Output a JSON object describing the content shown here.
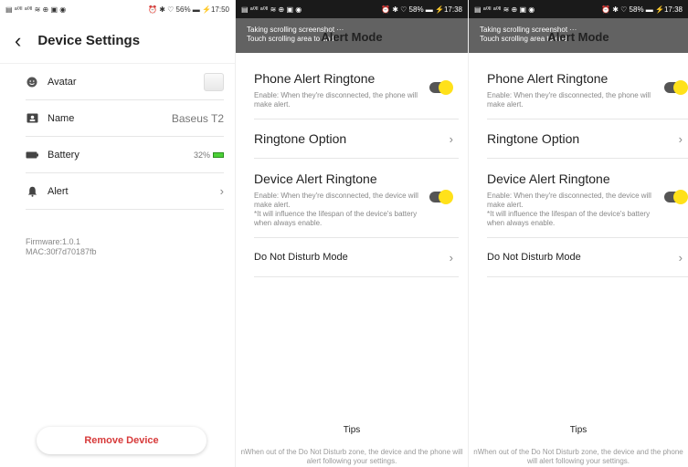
{
  "screen1": {
    "status_left": "▤ ᵃ⁰ˡˡ ᵃ⁰ˡˡ ≋ ⊕ ▣ ◉",
    "status_right": "⏰ ✱ ♡ 56% ▬ ⚡17:50",
    "title": "Device Settings",
    "rows": [
      {
        "label": "Avatar"
      },
      {
        "label": "Name",
        "value": "Baseus T2"
      },
      {
        "label": "Battery",
        "value": "32%"
      },
      {
        "label": "Alert"
      }
    ],
    "firmware": "Firmware:1.0.1",
    "mac": "MAC:30f7d70187fb",
    "remove_label": "Remove Device"
  },
  "screen2": {
    "status_left": "▤ ᵃ⁰ˡˡ ᵃ⁰ˡˡ ≋ ⊕ ▣ ◉",
    "status_right": "⏰ ✱ ♡ 58% ▬ ⚡17:38",
    "toast_line1": "Taking scrolling screenshot ···",
    "toast_line2": "Touch scrolling area to end",
    "title": "Alert Mode",
    "phone_alert_title": "Phone Alert Ringtone",
    "phone_alert_desc": "Enable: When they're disconnected, the phone will make alert.",
    "ringtone_option": "Ringtone Option",
    "device_alert_title": "Device Alert Ringtone",
    "device_alert_desc": "Enable: When they're disconnected, the device will make alert.\n*It will influence the lifespan of the device's battery when always enable.",
    "dnd": "Do Not Disturb Mode",
    "tips_title": "Tips",
    "tips_text": "nWhen out of the Do Not Disturb zone, the device and the phone will alert following your settings."
  },
  "screen3": {
    "status_left": "▤ ᵃ⁰ˡˡ ᵃ⁰ˡˡ ≋ ⊕ ▣ ◉",
    "status_right": "⏰ ✱ ♡ 58% ▬ ⚡17:38",
    "toast_line1": "Taking scrolling screenshot ···",
    "toast_line2": "Touch scrolling area to end",
    "title": "Alert Mode",
    "phone_alert_title": "Phone Alert Ringtone",
    "phone_alert_desc": "Enable: When they're disconnected, the phone will make alert.",
    "ringtone_option": "Ringtone Option",
    "device_alert_title": "Device Alert Ringtone",
    "device_alert_desc": "Enable: When they're disconnected, the device will make alert.\n*It will influence the lifespan of the device's battery when always enable.",
    "dnd": "Do Not Disturb Mode",
    "tips_title": "Tips",
    "tips_text": "nWhen out of the Do Not Disturb zone, the device and the phone will alert following your settings."
  },
  "colors": {
    "accent_toggle": "#ffe11a",
    "danger": "#d73a3a",
    "battery_green": "#4cd137"
  }
}
